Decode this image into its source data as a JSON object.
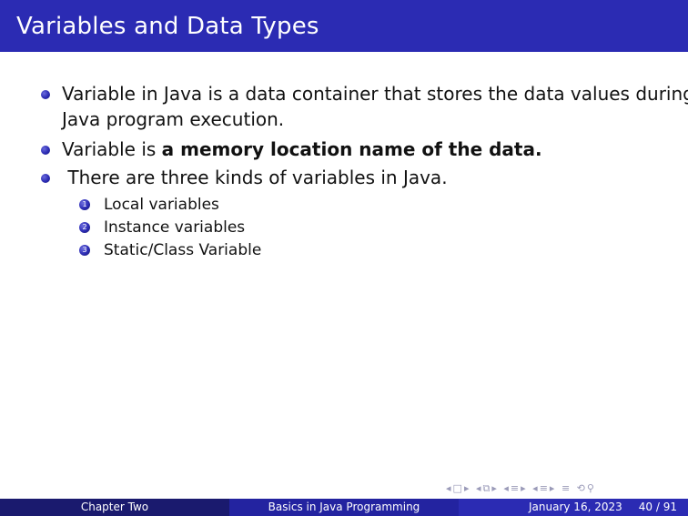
{
  "slide": {
    "title": "Variables and Data Types",
    "bullets": [
      {
        "line1": "Variable in Java is a data container that stores the data values during",
        "line2": "Java program execution."
      },
      {
        "prefix": "Variable is ",
        "bold": "a memory location name of the data."
      },
      {
        "text": " There are three kinds of variables in Java."
      }
    ],
    "enumeration": [
      {
        "num": "1",
        "label": "Local variables"
      },
      {
        "num": "2",
        "label": "Instance variables"
      },
      {
        "num": "3",
        "label": "Static/Class Variable"
      }
    ]
  },
  "footer": {
    "author": "Chapter Two",
    "short_title": "Basics in Java Programming",
    "date": "January 16, 2023",
    "page": "40 / 91"
  },
  "nav_icons": [
    "nav-prev-frame-icon",
    "nav-next-frame-icon",
    "nav-prev-subsection-icon",
    "nav-next-subsection-icon",
    "nav-prev-section-icon",
    "nav-next-section-icon",
    "nav-align-icon",
    "nav-search-icon"
  ],
  "colors": {
    "accent": "#2b2bb3",
    "footer_dark": "#1a1a6e",
    "footer_mid": "#2323a0"
  }
}
